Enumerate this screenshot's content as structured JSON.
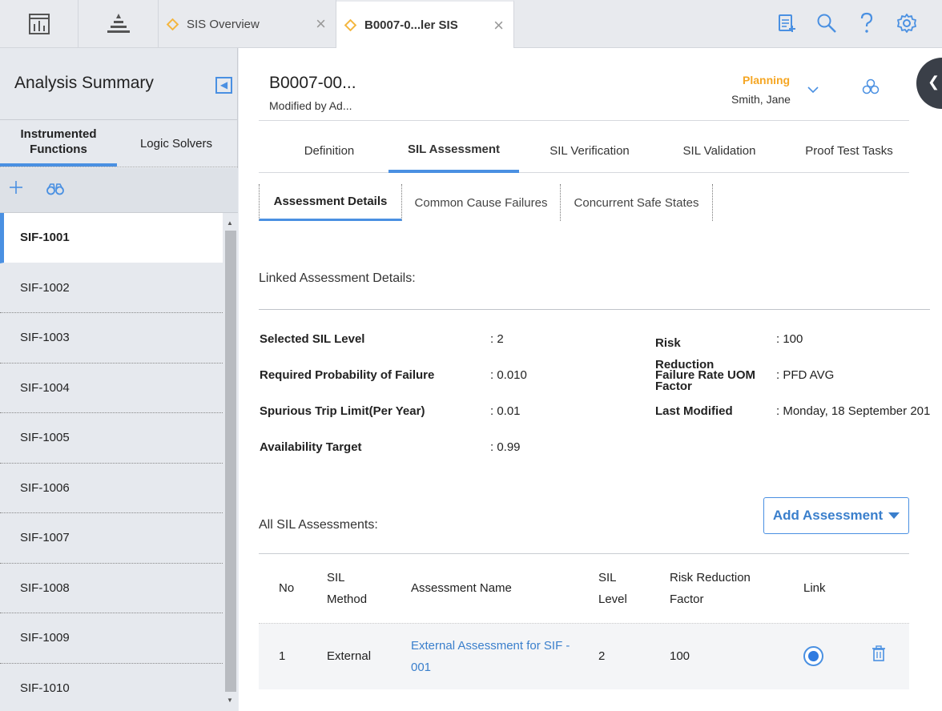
{
  "topbar": {
    "tabs": [
      {
        "label": "SIS Overview",
        "active": false
      },
      {
        "label": "B0007-0...ler SIS",
        "active": true
      }
    ],
    "close_glyph": "×",
    "icons": [
      "dashboard-icon",
      "asset-hierarchy-icon",
      "new-record-icon",
      "search-icon",
      "help-icon",
      "settings-icon"
    ]
  },
  "left": {
    "title": "Analysis Summary",
    "tabs": [
      {
        "label": "Instrumented Functions",
        "active": true
      },
      {
        "label": "Logic Solvers",
        "active": false
      }
    ],
    "items": [
      "SIF-1001",
      "SIF-1002",
      "SIF-1003",
      "SIF-1004",
      "SIF-1005",
      "SIF-1006",
      "SIF-1007",
      "SIF-1008",
      "SIF-1009",
      "SIF-1010"
    ],
    "selected": "SIF-1001"
  },
  "record": {
    "title": "B0007-00...",
    "subtitle": "Modified by Ad...",
    "state": "Planning",
    "owner": "Smith, Jane"
  },
  "main_tabs": [
    "Definition",
    "SIL Assessment",
    "SIL Verification",
    "SIL Validation",
    "Proof Test Tasks"
  ],
  "sub_tabs": [
    "Assessment Details",
    "Common Cause Failures",
    "Concurrent Safe States"
  ],
  "details": {
    "section_label": "Linked Assessment Details:",
    "left_fields": [
      {
        "label": "Selected SIL Level",
        "value": ": 2"
      },
      {
        "label": "Required Probability of Failure",
        "value": ": 0.010"
      },
      {
        "label": "Spurious Trip Limit(Per Year)",
        "value": ": 0.01"
      },
      {
        "label": "Availability Target",
        "value": ": 0.99"
      }
    ],
    "right_fields": [
      {
        "label": "Risk Reduction Factor",
        "value": ": 100"
      },
      {
        "label": "Failure Rate UOM",
        "value": ": PFD AVG"
      },
      {
        "label": "Last Modified",
        "value": ": Monday, 18 September 201"
      }
    ]
  },
  "assessments": {
    "section_label": "All SIL Assessments:",
    "add_button": "Add Assessment",
    "columns": {
      "no": "No",
      "sil_method": "SIL Method",
      "name": "Assessment Name",
      "sil_level": "SIL Level",
      "rrf": "Risk Reduction Factor",
      "link": "Link"
    },
    "rows": [
      {
        "no": "1",
        "sil_method": "External",
        "name": "External Assessment for SIF - 001",
        "sil_level": "2",
        "rrf": "100",
        "linked": true
      }
    ]
  },
  "colors": {
    "accent": "#4a90e2",
    "state": "#f5a623",
    "tab_marker": "#f4b63f"
  }
}
